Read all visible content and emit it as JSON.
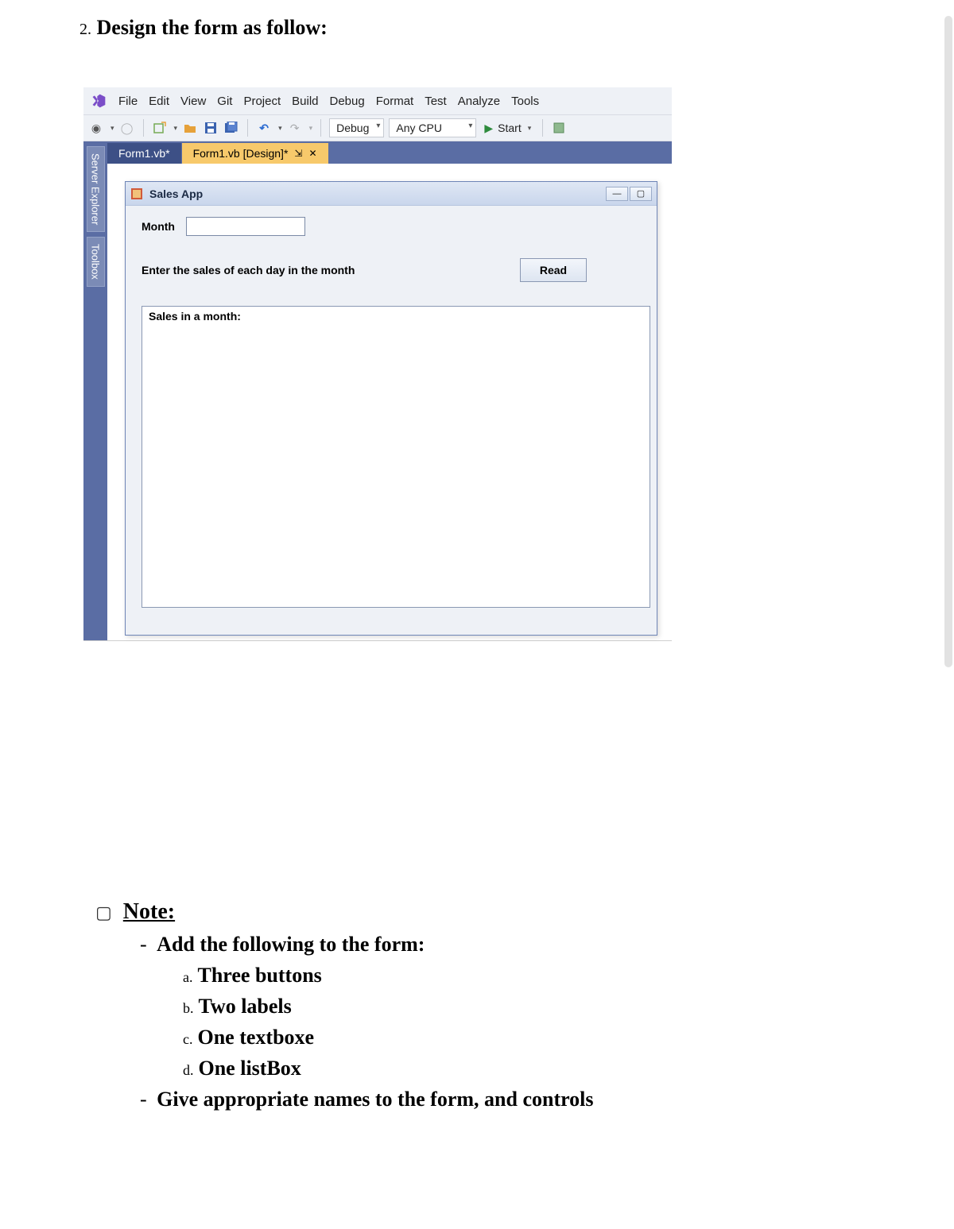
{
  "question": {
    "number": "2.",
    "text": "Design the form as follow:"
  },
  "vs": {
    "menus": [
      "File",
      "Edit",
      "View",
      "Git",
      "Project",
      "Build",
      "Debug",
      "Format",
      "Test",
      "Analyze",
      "Tools"
    ],
    "toolbar": {
      "config": "Debug",
      "platform": "Any CPU",
      "start": "Start"
    },
    "side_tabs": [
      "Server Explorer",
      "Toolbox"
    ],
    "doc_tabs": {
      "inactive": "Form1.vb*",
      "active": "Form1.vb [Design]*"
    },
    "form": {
      "title": "Sales App",
      "month_label": "Month",
      "prompt": "Enter the sales of each day in the month",
      "read_button": "Read",
      "listbox_header": "Sales in a month:"
    }
  },
  "notes": {
    "heading": "Note:",
    "line1": "Add the following to the form:",
    "items": {
      "a": "Three buttons",
      "b": "Two labels",
      "c": "One textboxe",
      "d": "One listBox"
    },
    "line2": "Give appropriate names to the form, and controls"
  },
  "letters": {
    "a": "a.",
    "b": "b.",
    "c": "c.",
    "d": "d."
  }
}
